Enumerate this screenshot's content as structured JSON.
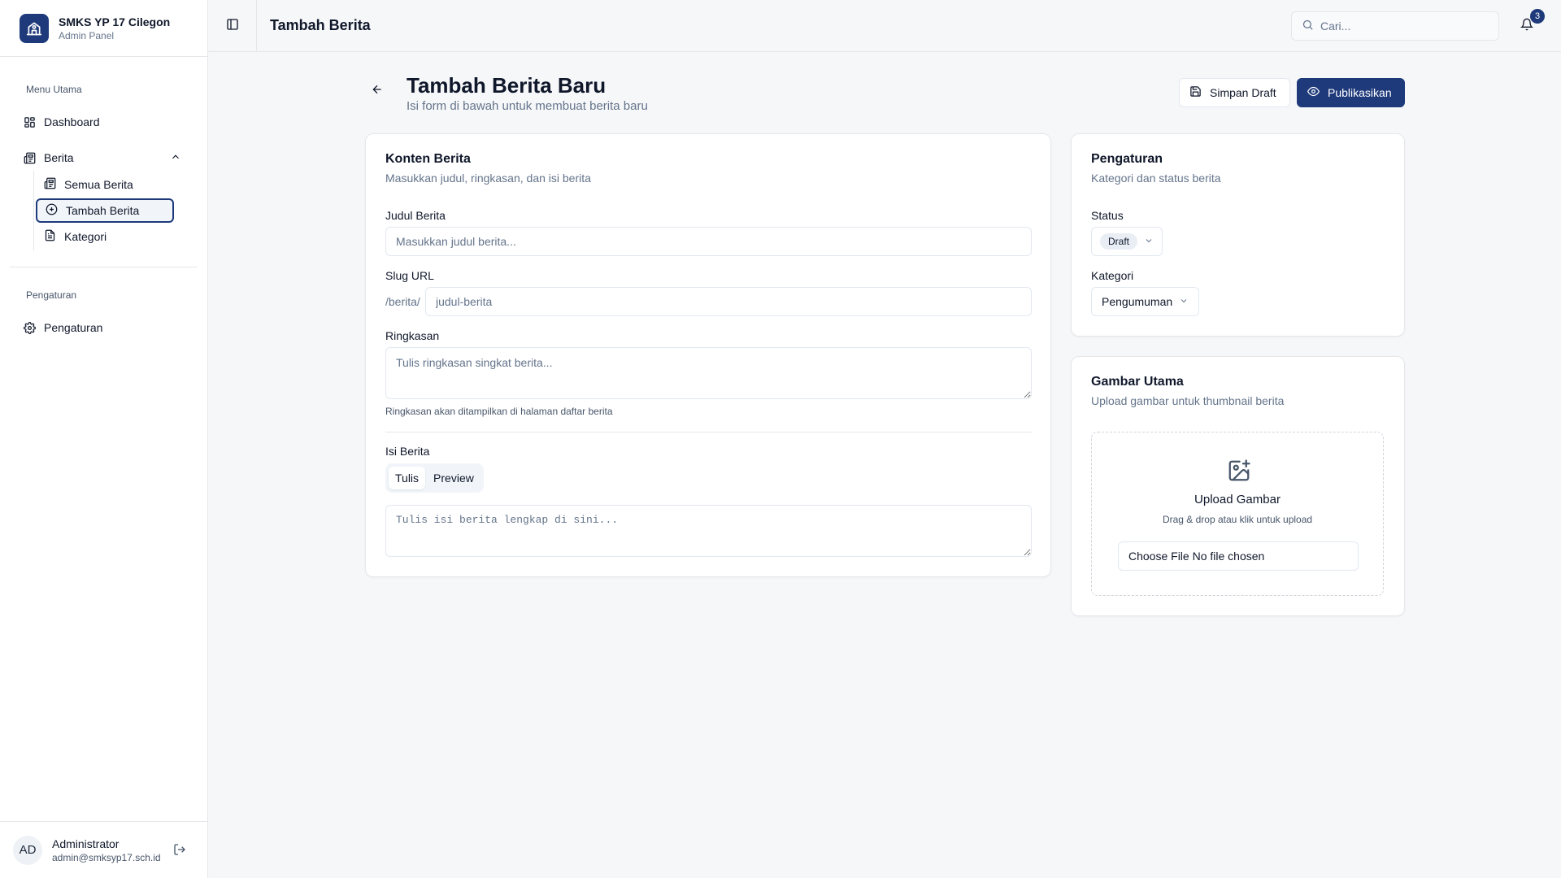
{
  "brand": {
    "name": "SMKS YP 17 Cilegon",
    "subtitle": "Admin Panel",
    "logo_icon": "school-icon",
    "color": "#1e3a7b"
  },
  "sidebar": {
    "section_main": "Menu Utama",
    "dashboard": "Dashboard",
    "berita": "Berita",
    "sub_items": [
      {
        "label": "Semua Berita",
        "icon": "newspaper-icon"
      },
      {
        "label": "Tambah Berita",
        "icon": "plus-circle-icon",
        "active": true
      },
      {
        "label": "Kategori",
        "icon": "file-icon"
      }
    ],
    "section_settings": "Pengaturan",
    "settings_item": "Pengaturan"
  },
  "user": {
    "initials": "AD",
    "name": "Administrator",
    "email": "admin@smksyp17.sch.id"
  },
  "topbar": {
    "title": "Tambah Berita",
    "search_placeholder": "Cari...",
    "notification_count": "3"
  },
  "page": {
    "title": "Tambah Berita Baru",
    "subtitle": "Isi form di bawah untuk membuat berita baru",
    "save_draft": "Simpan Draft",
    "publish": "Publikasikan"
  },
  "content_card": {
    "title": "Konten Berita",
    "subtitle": "Masukkan judul, ringkasan, dan isi berita",
    "title_label": "Judul Berita",
    "title_placeholder": "Masukkan judul berita...",
    "slug_label": "Slug URL",
    "slug_prefix": "/berita/",
    "slug_placeholder": "judul-berita",
    "summary_label": "Ringkasan",
    "summary_placeholder": "Tulis ringkasan singkat berita...",
    "summary_hint": "Ringkasan akan ditampilkan di halaman daftar berita",
    "body_label": "Isi Berita",
    "tab_write": "Tulis",
    "tab_preview": "Preview",
    "body_placeholder": "Tulis isi berita lengkap di sini..."
  },
  "settings_card": {
    "title": "Pengaturan",
    "subtitle": "Kategori dan status berita",
    "status_label": "Status",
    "status_value": "Draft",
    "category_label": "Kategori",
    "category_value": "Pengumuman"
  },
  "image_card": {
    "title": "Gambar Utama",
    "subtitle": "Upload gambar untuk thumbnail berita",
    "upload_title": "Upload Gambar",
    "upload_hint": "Drag & drop atau klik untuk upload",
    "file_input_text": "Choose File No file chosen"
  }
}
